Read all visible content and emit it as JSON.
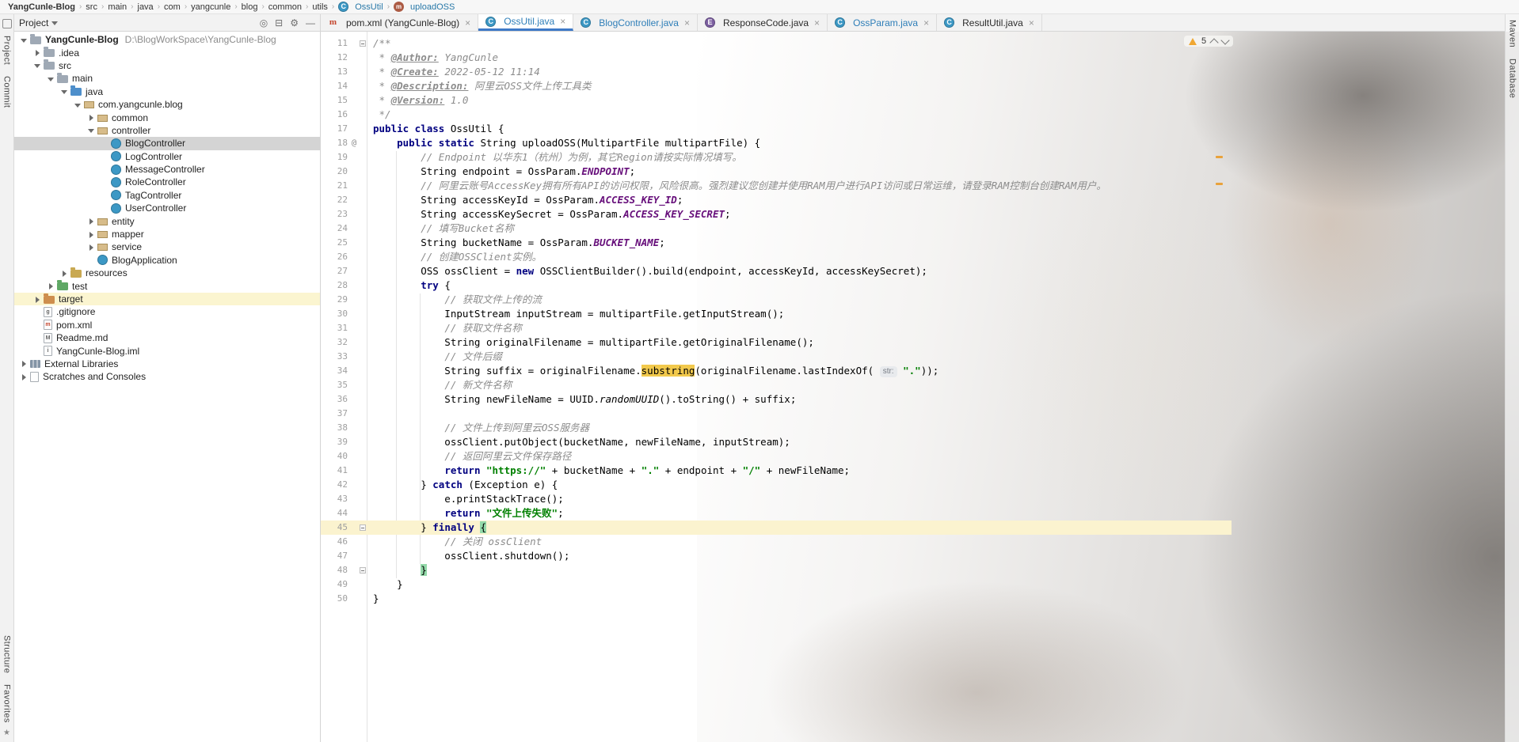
{
  "colors": {
    "accent_blue": "#3E79C7",
    "modified_file_blue": "#2E7EB8",
    "selection_gray": "#D4D4D4",
    "target_row_yellow": "#FBF5D0",
    "caret_line": "#FBF3CF",
    "search_highlight": "#F2C94C",
    "brace_match_green": "#93D9A9",
    "warning_orange": "#F0A732",
    "keyword_navy": "#000080",
    "string_green": "#008000",
    "constant_purple": "#660E7A",
    "comment_gray": "#8C8C8C"
  },
  "breadcrumb_bar": {
    "items": [
      "YangCunle-Blog",
      "src",
      "main",
      "java",
      "com",
      "yangcunle",
      "blog",
      "common",
      "utils"
    ],
    "class_item": "OssUtil",
    "method_item": "uploadOSS"
  },
  "stripes": {
    "left_top": [
      "Project",
      "Commit"
    ],
    "left_bottom": [
      "Structure",
      "Favorites"
    ],
    "right_top": [
      "Maven",
      "Database"
    ]
  },
  "project_panel": {
    "title": "Project",
    "items": [
      {
        "label": "YangCunle-Blog",
        "hint": "D:\\BlogWorkSpace\\YangCunle-Blog",
        "depth": 0,
        "arrow": "open",
        "icon": "folder",
        "bold": true
      },
      {
        "label": ".idea",
        "depth": 1,
        "arrow": "closed",
        "icon": "folder"
      },
      {
        "label": "src",
        "depth": 1,
        "arrow": "open",
        "icon": "folder"
      },
      {
        "label": "main",
        "depth": 2,
        "arrow": "open",
        "icon": "folder"
      },
      {
        "label": "java",
        "depth": 3,
        "arrow": "open",
        "icon": "folder java"
      },
      {
        "label": "com.yangcunle.blog",
        "depth": 4,
        "arrow": "open",
        "icon": "package"
      },
      {
        "label": "common",
        "depth": 5,
        "arrow": "closed",
        "icon": "package"
      },
      {
        "label": "controller",
        "depth": 5,
        "arrow": "open",
        "icon": "package"
      },
      {
        "label": "BlogController",
        "depth": 6,
        "arrow": "none",
        "icon": "class",
        "selected": true
      },
      {
        "label": "LogController",
        "depth": 6,
        "arrow": "none",
        "icon": "class"
      },
      {
        "label": "MessageController",
        "depth": 6,
        "arrow": "none",
        "icon": "class"
      },
      {
        "label": "RoleController",
        "depth": 6,
        "arrow": "none",
        "icon": "class"
      },
      {
        "label": "TagController",
        "depth": 6,
        "arrow": "none",
        "icon": "class"
      },
      {
        "label": "UserController",
        "depth": 6,
        "arrow": "none",
        "icon": "class"
      },
      {
        "label": "entity",
        "depth": 5,
        "arrow": "closed",
        "icon": "package"
      },
      {
        "label": "mapper",
        "depth": 5,
        "arrow": "closed",
        "icon": "package"
      },
      {
        "label": "service",
        "depth": 5,
        "arrow": "closed",
        "icon": "package"
      },
      {
        "label": "BlogApplication",
        "depth": 5,
        "arrow": "none",
        "icon": "class"
      },
      {
        "label": "resources",
        "depth": 3,
        "arrow": "closed",
        "icon": "folder resources"
      },
      {
        "label": "test",
        "depth": 2,
        "arrow": "closed",
        "icon": "folder test"
      },
      {
        "label": "target",
        "depth": 1,
        "arrow": "closed",
        "icon": "folder excluded",
        "highlight": true
      },
      {
        "label": ".gitignore",
        "depth": 1,
        "arrow": "none",
        "icon": "file",
        "letter": "g"
      },
      {
        "label": "pom.xml",
        "depth": 1,
        "arrow": "none",
        "icon": "file mvn",
        "letter": "m"
      },
      {
        "label": "Readme.md",
        "depth": 1,
        "arrow": "none",
        "icon": "file",
        "letter": "M"
      },
      {
        "label": "YangCunle-Blog.iml",
        "depth": 1,
        "arrow": "none",
        "icon": "file",
        "letter": "i"
      },
      {
        "label": "External Libraries",
        "depth": 0,
        "arrow": "closed",
        "icon": "lib"
      },
      {
        "label": "Scratches and Consoles",
        "depth": 0,
        "arrow": "closed",
        "icon": "file",
        "letter": ""
      }
    ]
  },
  "tabs": [
    {
      "label": "pom.xml (YangCunle-Blog)",
      "icon": "maven",
      "letter": "m",
      "state": "normal"
    },
    {
      "label": "OssUtil.java",
      "icon": "class",
      "letter": "C",
      "state": "active"
    },
    {
      "label": "BlogController.java",
      "icon": "class",
      "letter": "C",
      "state": "modified"
    },
    {
      "label": "ResponseCode.java",
      "icon": "enum",
      "letter": "E",
      "state": "normal"
    },
    {
      "label": "OssParam.java",
      "icon": "class",
      "letter": "C",
      "state": "modified"
    },
    {
      "label": "ResultUtil.java",
      "icon": "class",
      "letter": "C",
      "state": "normal"
    }
  ],
  "editor": {
    "warning_count": "5",
    "lines": [
      {
        "n": 11,
        "fold": true,
        "seg": [
          [
            "d",
            "/**"
          ]
        ]
      },
      {
        "n": 12,
        "seg": [
          [
            "d",
            " * "
          ],
          [
            "dt",
            "@Author:"
          ],
          [
            "d",
            " YangCunle"
          ]
        ]
      },
      {
        "n": 13,
        "seg": [
          [
            "d",
            " * "
          ],
          [
            "dt",
            "@Create:"
          ],
          [
            "d",
            " 2022-05-12 11:14"
          ]
        ]
      },
      {
        "n": 14,
        "seg": [
          [
            "d",
            " * "
          ],
          [
            "dt",
            "@Description:"
          ],
          [
            "d",
            " 阿里云OSS文件上传工具类"
          ]
        ]
      },
      {
        "n": 15,
        "seg": [
          [
            "d",
            " * "
          ],
          [
            "dt",
            "@Version:"
          ],
          [
            "d",
            " 1.0"
          ]
        ]
      },
      {
        "n": 16,
        "seg": [
          [
            "d",
            " */"
          ]
        ]
      },
      {
        "n": 17,
        "seg": [
          [
            "k",
            "public class "
          ],
          [
            "p",
            "OssUtil {"
          ]
        ]
      },
      {
        "n": 18,
        "ann": "@",
        "seg": [
          [
            "p",
            "    "
          ],
          [
            "k",
            "public static "
          ],
          [
            "p",
            "String uploadOSS(MultipartFile multipartFile) {"
          ]
        ]
      },
      {
        "n": 19,
        "seg": [
          [
            "p",
            "        "
          ],
          [
            "c",
            "// Endpoint 以华东1（杭州）为例，其它Region请按实际情况填写。"
          ]
        ]
      },
      {
        "n": 20,
        "seg": [
          [
            "p",
            "        String endpoint = OssParam."
          ],
          [
            "f",
            "ENDPOINT"
          ],
          [
            "p",
            ";"
          ]
        ]
      },
      {
        "n": 21,
        "seg": [
          [
            "p",
            "        "
          ],
          [
            "c",
            "// 阿里云账号AccessKey拥有所有API的访问权限，风险很高。强烈建议您创建并使用RAM用户进行API访问或日常运维，请登录RAM控制台创建RAM用户。"
          ]
        ]
      },
      {
        "n": 22,
        "seg": [
          [
            "p",
            "        String accessKeyId = OssParam."
          ],
          [
            "f",
            "ACCESS_KEY_ID"
          ],
          [
            "p",
            ";"
          ]
        ]
      },
      {
        "n": 23,
        "seg": [
          [
            "p",
            "        String accessKeySecret = OssParam."
          ],
          [
            "f",
            "ACCESS_KEY_SECRET"
          ],
          [
            "p",
            ";"
          ]
        ]
      },
      {
        "n": 24,
        "seg": [
          [
            "p",
            "        "
          ],
          [
            "c",
            "// 填写Bucket名称"
          ]
        ]
      },
      {
        "n": 25,
        "seg": [
          [
            "p",
            "        String bucketName = OssParam."
          ],
          [
            "f",
            "BUCKET_NAME"
          ],
          [
            "p",
            ";"
          ]
        ]
      },
      {
        "n": 26,
        "seg": [
          [
            "p",
            "        "
          ],
          [
            "c",
            "// 创建OSSClient实例。"
          ]
        ]
      },
      {
        "n": 27,
        "seg": [
          [
            "p",
            "        OSS ossClient = "
          ],
          [
            "k",
            "new"
          ],
          [
            "p",
            " OSSClientBuilder().build(endpoint, accessKeyId, accessKeySecret);"
          ]
        ]
      },
      {
        "n": 28,
        "seg": [
          [
            "p",
            "        "
          ],
          [
            "k",
            "try"
          ],
          [
            "p",
            " {"
          ]
        ]
      },
      {
        "n": 29,
        "seg": [
          [
            "p",
            "            "
          ],
          [
            "c",
            "// 获取文件上传的流"
          ]
        ]
      },
      {
        "n": 30,
        "seg": [
          [
            "p",
            "            InputStream inputStream = multipartFile.getInputStream();"
          ]
        ]
      },
      {
        "n": 31,
        "seg": [
          [
            "p",
            "            "
          ],
          [
            "c",
            "// 获取文件名称"
          ]
        ]
      },
      {
        "n": 32,
        "seg": [
          [
            "p",
            "            String originalFilename = multipartFile.getOriginalFilename();"
          ]
        ]
      },
      {
        "n": 33,
        "seg": [
          [
            "p",
            "            "
          ],
          [
            "c",
            "// 文件后缀"
          ]
        ]
      },
      {
        "n": 34,
        "seg": [
          [
            "p",
            "            String suffix = originalFilename."
          ],
          [
            "hl",
            "substring"
          ],
          [
            "p",
            "(originalFilename.lastIndexOf( "
          ],
          [
            "chip",
            "str:"
          ],
          [
            "p",
            " "
          ],
          [
            "s",
            "\".\""
          ],
          [
            "p",
            "));"
          ]
        ]
      },
      {
        "n": 35,
        "seg": [
          [
            "p",
            "            "
          ],
          [
            "c",
            "// 新文件名称"
          ]
        ]
      },
      {
        "n": 36,
        "seg": [
          [
            "p",
            "            String newFileName = UUID."
          ],
          [
            "it",
            "randomUUID"
          ],
          [
            "p",
            "().toString() + suffix;"
          ]
        ]
      },
      {
        "n": 37,
        "seg": []
      },
      {
        "n": 38,
        "seg": [
          [
            "p",
            "            "
          ],
          [
            "c",
            "// 文件上传到阿里云OSS服务器"
          ]
        ]
      },
      {
        "n": 39,
        "seg": [
          [
            "p",
            "            ossClient.putObject(bucketName, newFileName, inputStream);"
          ]
        ]
      },
      {
        "n": 40,
        "seg": [
          [
            "p",
            "            "
          ],
          [
            "c",
            "// 返回阿里云文件保存路径"
          ]
        ]
      },
      {
        "n": 41,
        "seg": [
          [
            "p",
            "            "
          ],
          [
            "k",
            "return "
          ],
          [
            "s",
            "\"https://\""
          ],
          [
            "p",
            " + bucketName + "
          ],
          [
            "s",
            "\".\""
          ],
          [
            "p",
            " + endpoint + "
          ],
          [
            "s",
            "\"/\""
          ],
          [
            "p",
            " + newFileName;"
          ]
        ]
      },
      {
        "n": 42,
        "seg": [
          [
            "p",
            "        } "
          ],
          [
            "k",
            "catch"
          ],
          [
            "p",
            " (Exception e) {"
          ]
        ]
      },
      {
        "n": 43,
        "seg": [
          [
            "p",
            "            e.printStackTrace();"
          ]
        ]
      },
      {
        "n": 44,
        "seg": [
          [
            "p",
            "            "
          ],
          [
            "k",
            "return "
          ],
          [
            "s",
            "\"文件上传失败\""
          ],
          [
            "p",
            ";"
          ]
        ]
      },
      {
        "n": 45,
        "caret": true,
        "fold": true,
        "seg": [
          [
            "p",
            "        } "
          ],
          [
            "k",
            "finally"
          ],
          [
            "p",
            " "
          ],
          [
            "bm",
            "{"
          ]
        ]
      },
      {
        "n": 46,
        "seg": [
          [
            "p",
            "            "
          ],
          [
            "c",
            "// 关闭 ossClient"
          ]
        ]
      },
      {
        "n": 47,
        "seg": [
          [
            "p",
            "            ossClient.shutdown();"
          ]
        ]
      },
      {
        "n": 48,
        "fold": true,
        "seg": [
          [
            "p",
            "        "
          ],
          [
            "bm",
            "}"
          ]
        ]
      },
      {
        "n": 49,
        "seg": [
          [
            "p",
            "    }"
          ]
        ]
      },
      {
        "n": 50,
        "seg": [
          [
            "p",
            "}"
          ]
        ]
      }
    ]
  }
}
